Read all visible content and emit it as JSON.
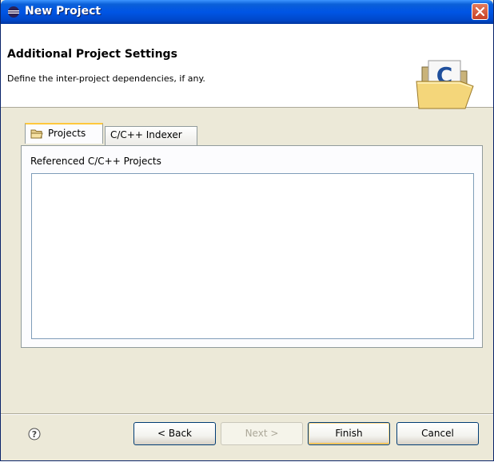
{
  "window": {
    "title": "New Project",
    "close_icon": "close-icon"
  },
  "header": {
    "title": "Additional Project Settings",
    "description": "Define the inter-project dependencies, if any.",
    "icon": "c-project-folder-icon"
  },
  "tabs": [
    {
      "label": "Projects",
      "icon": "folder-icon",
      "active": true
    },
    {
      "label": "C/C++ Indexer",
      "active": false
    }
  ],
  "projects_tab": {
    "list_label": "Referenced C/C++ Projects",
    "items": []
  },
  "footer": {
    "help_icon": "help-icon",
    "back_label": "< Back",
    "next_label": "Next >",
    "next_enabled": false,
    "finish_label": "Finish",
    "cancel_label": "Cancel"
  },
  "colors": {
    "title_bar": "#0055e5",
    "active_tab_accent": "#ffc83c",
    "dialog_background": "#ece9d8"
  }
}
